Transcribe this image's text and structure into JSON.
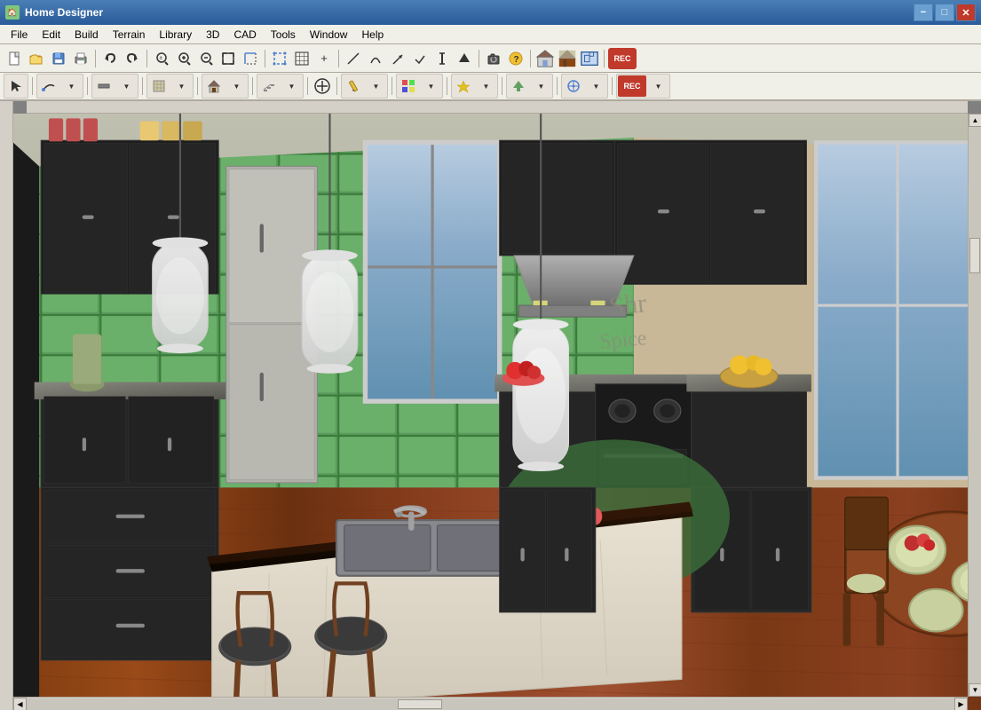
{
  "app": {
    "title": "Home Designer",
    "icon": "🏠"
  },
  "window_controls": {
    "minimize": "−",
    "maximize": "□",
    "close": "✕",
    "inner_minimize": "−",
    "inner_maximize": "□",
    "inner_close": "✕"
  },
  "menu": {
    "items": [
      "File",
      "Edit",
      "Build",
      "Terrain",
      "Library",
      "3D",
      "CAD",
      "Tools",
      "Window",
      "Help"
    ]
  },
  "toolbar1": {
    "buttons": [
      {
        "name": "new",
        "icon": "📄"
      },
      {
        "name": "open",
        "icon": "📂"
      },
      {
        "name": "save",
        "icon": "💾"
      },
      {
        "name": "print",
        "icon": "🖨"
      },
      {
        "name": "undo",
        "icon": "↩"
      },
      {
        "name": "redo",
        "icon": "↪"
      },
      {
        "name": "zoom-out-scroll",
        "icon": "🔍"
      },
      {
        "name": "zoom-in",
        "icon": "⊕"
      },
      {
        "name": "zoom-out",
        "icon": "⊖"
      },
      {
        "name": "fill-window",
        "icon": "⤢"
      },
      {
        "name": "zoom-select",
        "icon": "⊞"
      },
      {
        "name": "grid",
        "icon": "⊞"
      },
      {
        "name": "add",
        "icon": "+"
      },
      {
        "name": "line",
        "icon": "╱"
      },
      {
        "name": "arc",
        "icon": "⌒"
      },
      {
        "name": "arrow",
        "icon": "➤"
      },
      {
        "name": "check",
        "icon": "✓"
      },
      {
        "name": "vertical",
        "icon": "│"
      },
      {
        "name": "up-arrow",
        "icon": "▲"
      },
      {
        "name": "camera",
        "icon": "📷"
      },
      {
        "name": "help",
        "icon": "?"
      },
      {
        "name": "sep1",
        "type": "separator"
      },
      {
        "name": "house",
        "icon": "🏠"
      },
      {
        "name": "roof",
        "icon": "⌂"
      },
      {
        "name": "tree",
        "icon": "🌲"
      },
      {
        "name": "rec",
        "icon": "REC"
      }
    ]
  },
  "toolbar2": {
    "groups": [
      {
        "name": "select-group",
        "buttons": [
          {
            "icon": "↖",
            "name": "select-arrow"
          }
        ]
      },
      {
        "name": "draw-group",
        "buttons": [
          {
            "icon": "∿",
            "name": "draw-line"
          },
          {
            "icon": "▼",
            "name": "draw-dropdown"
          }
        ]
      },
      {
        "name": "wall-group",
        "buttons": [
          {
            "icon": "⊟",
            "name": "wall"
          },
          {
            "icon": "▼",
            "name": "wall-dropdown"
          }
        ]
      },
      {
        "name": "floor-group",
        "buttons": [
          {
            "icon": "▦",
            "name": "floor"
          },
          {
            "icon": "▼",
            "name": "floor-dropdown"
          }
        ]
      },
      {
        "name": "room-group",
        "buttons": [
          {
            "icon": "🏠",
            "name": "room"
          },
          {
            "icon": "▼",
            "name": "room-dropdown"
          }
        ]
      },
      {
        "name": "stair-group",
        "buttons": [
          {
            "icon": "▤",
            "name": "stair"
          },
          {
            "icon": "▼",
            "name": "stair-dropdown"
          }
        ]
      },
      {
        "name": "place-group",
        "buttons": [
          {
            "icon": "⊕",
            "name": "place"
          }
        ]
      },
      {
        "name": "camera2-group",
        "buttons": [
          {
            "icon": "✏",
            "name": "pencil"
          },
          {
            "icon": "▼",
            "name": "pencil-dropdown"
          }
        ]
      },
      {
        "name": "material-group",
        "buttons": [
          {
            "icon": "🎨",
            "name": "material"
          },
          {
            "icon": "▼",
            "name": "material-dropdown"
          }
        ]
      },
      {
        "name": "sym-group",
        "buttons": [
          {
            "icon": "✦",
            "name": "symbol"
          },
          {
            "icon": "▼",
            "name": "symbol-dropdown"
          }
        ]
      },
      {
        "name": "move-group",
        "buttons": [
          {
            "icon": "✦",
            "name": "move"
          },
          {
            "icon": "▼",
            "name": "move-dropdown"
          }
        ]
      },
      {
        "name": "transform-group",
        "buttons": [
          {
            "icon": "↑",
            "name": "transform"
          },
          {
            "icon": "▼",
            "name": "transform-dropdown"
          }
        ]
      },
      {
        "name": "cross-group",
        "buttons": [
          {
            "icon": "⊕",
            "name": "cross"
          },
          {
            "icon": "▼",
            "name": "cross-dropdown"
          }
        ]
      },
      {
        "name": "rec-group",
        "buttons": [
          {
            "icon": "⏺",
            "name": "record"
          },
          {
            "icon": "▼",
            "name": "record-dropdown"
          }
        ]
      }
    ]
  },
  "viewport": {
    "content_type": "3d_kitchen_render"
  },
  "statusbar": {
    "text": ""
  }
}
